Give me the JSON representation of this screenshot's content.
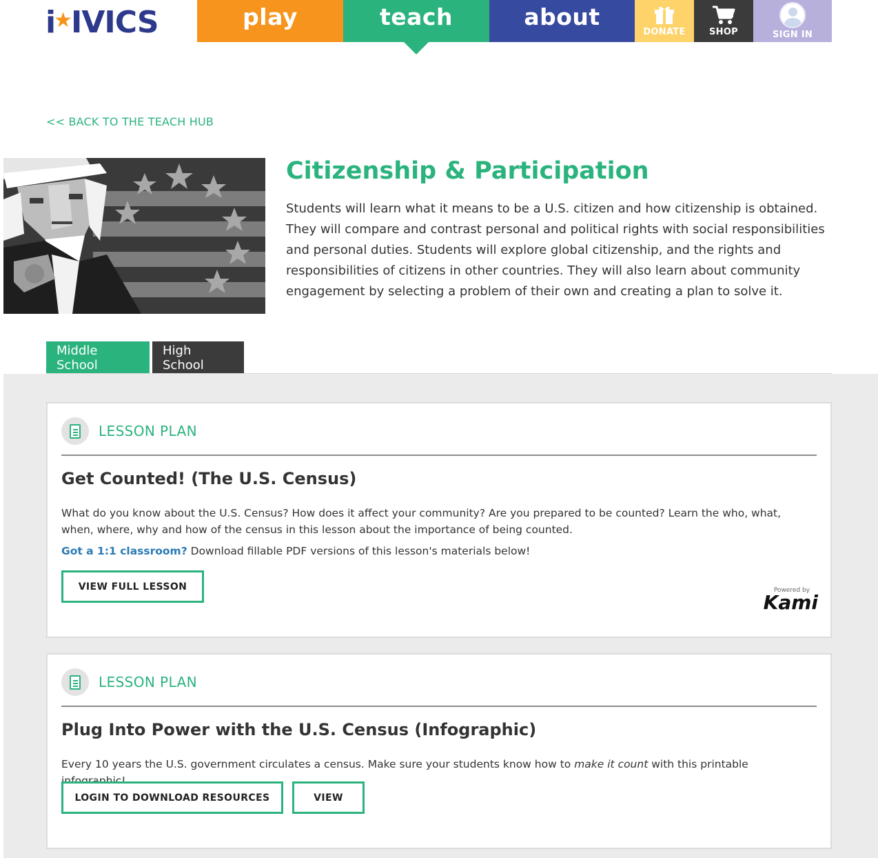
{
  "header": {
    "logo_text": "iCivics",
    "logo_left": "i",
    "logo_right": "IVICS",
    "nav": {
      "play": "play",
      "teach": "teach",
      "about": "about",
      "donate": "DONATE",
      "shop": "SHOP",
      "sign_in": "SIGN IN"
    },
    "colors": {
      "play": "#f7941d",
      "teach": "#2bb37e",
      "about": "#364aa0",
      "donate": "#fdd36a",
      "shop": "#3b3b3b",
      "sign_in": "#b7b0dc"
    }
  },
  "back_link": "<< BACK TO THE TEACH HUB",
  "hero": {
    "title": "Citizenship & Participation",
    "description": "Students will learn what it means to be a U.S. citizen and how citizenship is obtained. They will compare and contrast personal and political rights with social responsibilities and personal duties. Students will explore global citizenship, and the rights and responsibilities of citizens in other countries. They will also learn about community engagement by selecting a problem of their own and creating a plan to solve it."
  },
  "tabs": [
    {
      "label": "Middle School",
      "active": true
    },
    {
      "label": "High School",
      "active": false
    }
  ],
  "cards": [
    {
      "kicker": "LESSON PLAN",
      "title": "Get Counted! (The U.S. Census)",
      "description": "What do you know about the U.S. Census? How does it affect your community? Are you prepared to be counted? Learn the who, what, when, where, why and how of the census in this lesson about the importance of being counted.",
      "note_link": "Got a 1:1 classroom?",
      "note_text": " Download fillable PDF versions of this lesson's materials below!",
      "button": "VIEW FULL LESSON",
      "kami_small": "Powered by",
      "kami_big": "Kami"
    },
    {
      "kicker": "LESSON PLAN",
      "title": "Plug Into Power with the U.S. Census (Infographic)",
      "desc_before": "Every 10 years the U.S. government circulates a census. Make sure your students know how to ",
      "desc_em": "make it count",
      "desc_after": " with this printable infographic!",
      "button_login": "LOGIN TO DOWNLOAD RESOURCES",
      "button_view": "VIEW"
    }
  ]
}
